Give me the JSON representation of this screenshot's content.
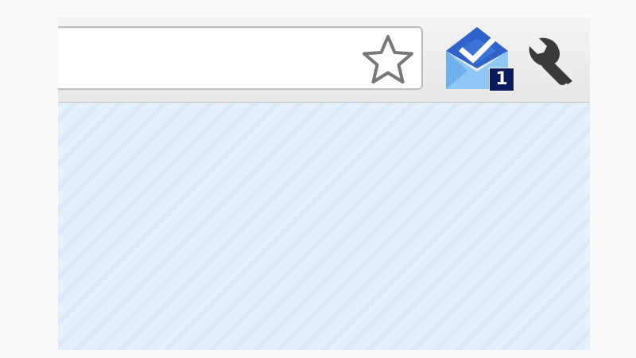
{
  "toolbar": {
    "omnibox": {
      "value": "",
      "placeholder": ""
    },
    "bookmark_star": {
      "icon": "star-outline-icon",
      "color": "#777777"
    },
    "inbox_extension": {
      "icon": "inbox-envelope-check-icon",
      "badge_count": "1",
      "badge_color": "#0b1a5e",
      "colors": {
        "envelope_dark": "#2f63c9",
        "envelope_light": "#8ec6f5",
        "check": "#ffffff"
      }
    },
    "settings": {
      "icon": "wrench-icon",
      "color": "#3a3a3a"
    }
  },
  "content": {
    "background": "#e4f0fc",
    "stripe": "#dbe9f8"
  }
}
